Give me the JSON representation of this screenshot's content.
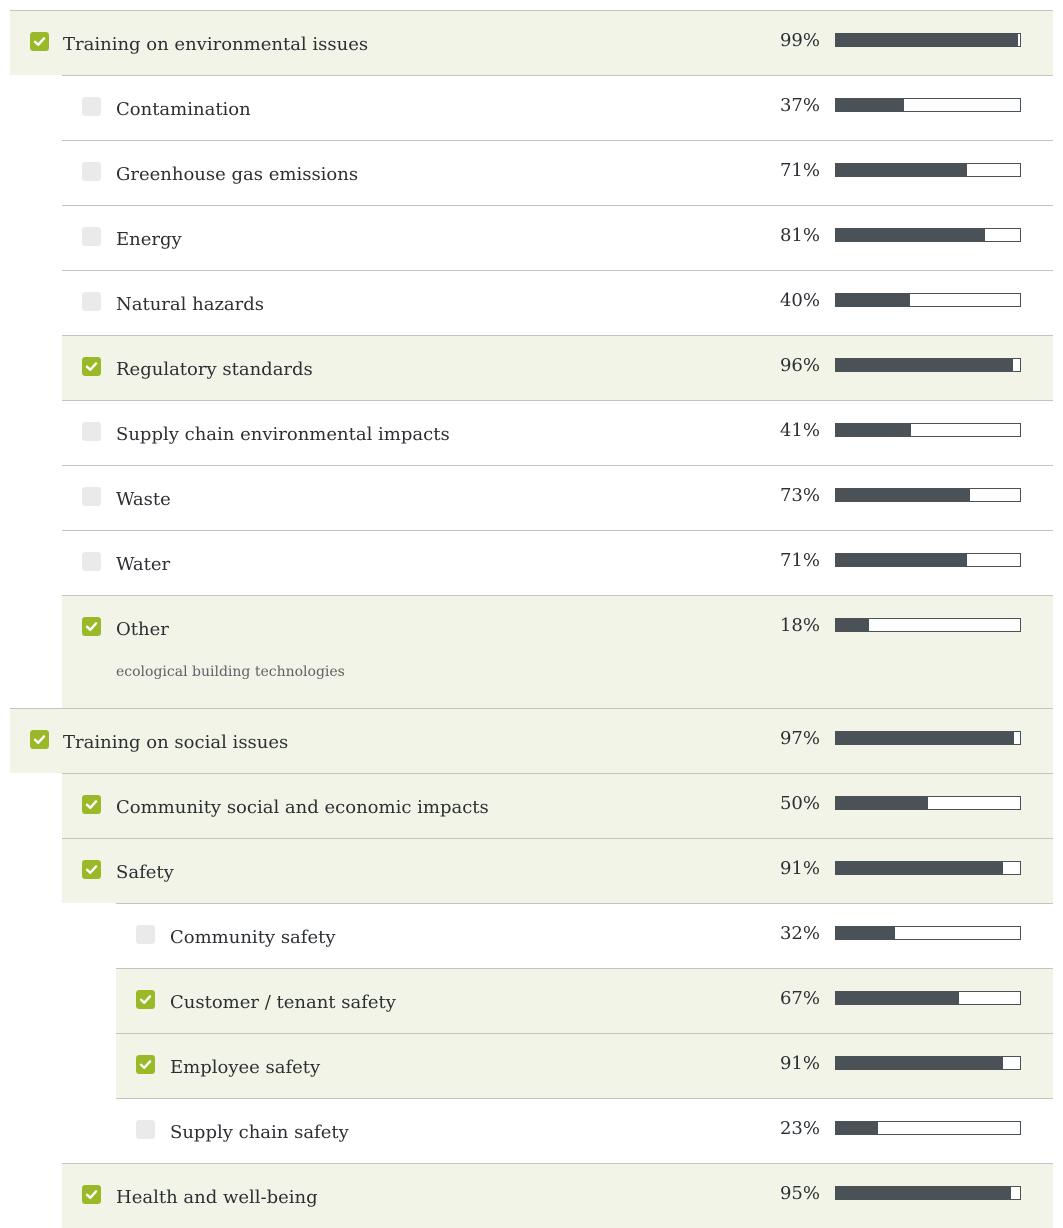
{
  "colors": {
    "checked_row_bg": "#f1f4e7",
    "checkbox_checked": "#9ab928",
    "checkbox_unchecked": "#eaeaea",
    "bar_fill": "#4a5157",
    "divider": "#c4c4c4"
  },
  "rows": [
    {
      "label": "Training on environmental issues",
      "percent": "99%",
      "value": 99,
      "checked": true,
      "level": 0
    },
    {
      "label": "Contamination",
      "percent": "37%",
      "value": 37,
      "checked": false,
      "level": 1
    },
    {
      "label": "Greenhouse gas emissions",
      "percent": "71%",
      "value": 71,
      "checked": false,
      "level": 1
    },
    {
      "label": "Energy",
      "percent": "81%",
      "value": 81,
      "checked": false,
      "level": 1
    },
    {
      "label": "Natural hazards",
      "percent": "40%",
      "value": 40,
      "checked": false,
      "level": 1
    },
    {
      "label": "Regulatory standards",
      "percent": "96%",
      "value": 96,
      "checked": true,
      "level": 1
    },
    {
      "label": "Supply chain environmental impacts",
      "percent": "41%",
      "value": 41,
      "checked": false,
      "level": 1
    },
    {
      "label": "Waste",
      "percent": "73%",
      "value": 73,
      "checked": false,
      "level": 1
    },
    {
      "label": "Water",
      "percent": "71%",
      "value": 71,
      "checked": false,
      "level": 1
    },
    {
      "label": "Other",
      "percent": "18%",
      "value": 18,
      "checked": true,
      "level": 1,
      "note": "ecological building technologies"
    },
    {
      "label": "Training on social issues",
      "percent": "97%",
      "value": 97,
      "checked": true,
      "level": 0
    },
    {
      "label": "Community social and economic impacts",
      "percent": "50%",
      "value": 50,
      "checked": true,
      "level": 1
    },
    {
      "label": "Safety",
      "percent": "91%",
      "value": 91,
      "checked": true,
      "level": 1
    },
    {
      "label": "Community safety",
      "percent": "32%",
      "value": 32,
      "checked": false,
      "level": 2
    },
    {
      "label": "Customer / tenant safety",
      "percent": "67%",
      "value": 67,
      "checked": true,
      "level": 2
    },
    {
      "label": "Employee safety",
      "percent": "91%",
      "value": 91,
      "checked": true,
      "level": 2
    },
    {
      "label": "Supply chain safety",
      "percent": "23%",
      "value": 23,
      "checked": false,
      "level": 2
    },
    {
      "label": "Health and well-being",
      "percent": "95%",
      "value": 95,
      "checked": true,
      "level": 1
    }
  ]
}
